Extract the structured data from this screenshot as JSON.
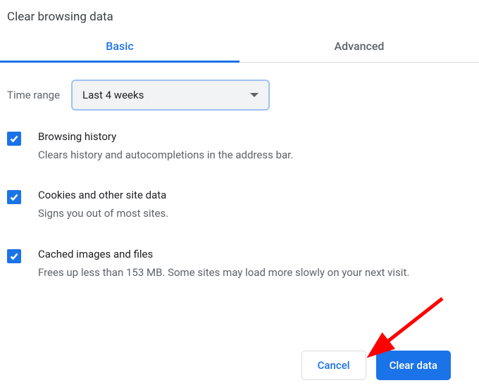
{
  "dialog": {
    "title": "Clear browsing data"
  },
  "tabs": {
    "basic": "Basic",
    "advanced": "Advanced"
  },
  "time_range": {
    "label": "Time range",
    "value": "Last 4 weeks"
  },
  "options": {
    "history": {
      "title": "Browsing history",
      "desc": "Clears history and autocompletions in the address bar.",
      "checked": true
    },
    "cookies": {
      "title": "Cookies and other site data",
      "desc": "Signs you out of most sites.",
      "checked": true
    },
    "cache": {
      "title": "Cached images and files",
      "desc": "Frees up less than 153 MB. Some sites may load more slowly on your next visit.",
      "checked": true
    }
  },
  "buttons": {
    "cancel": "Cancel",
    "clear": "Clear data"
  }
}
